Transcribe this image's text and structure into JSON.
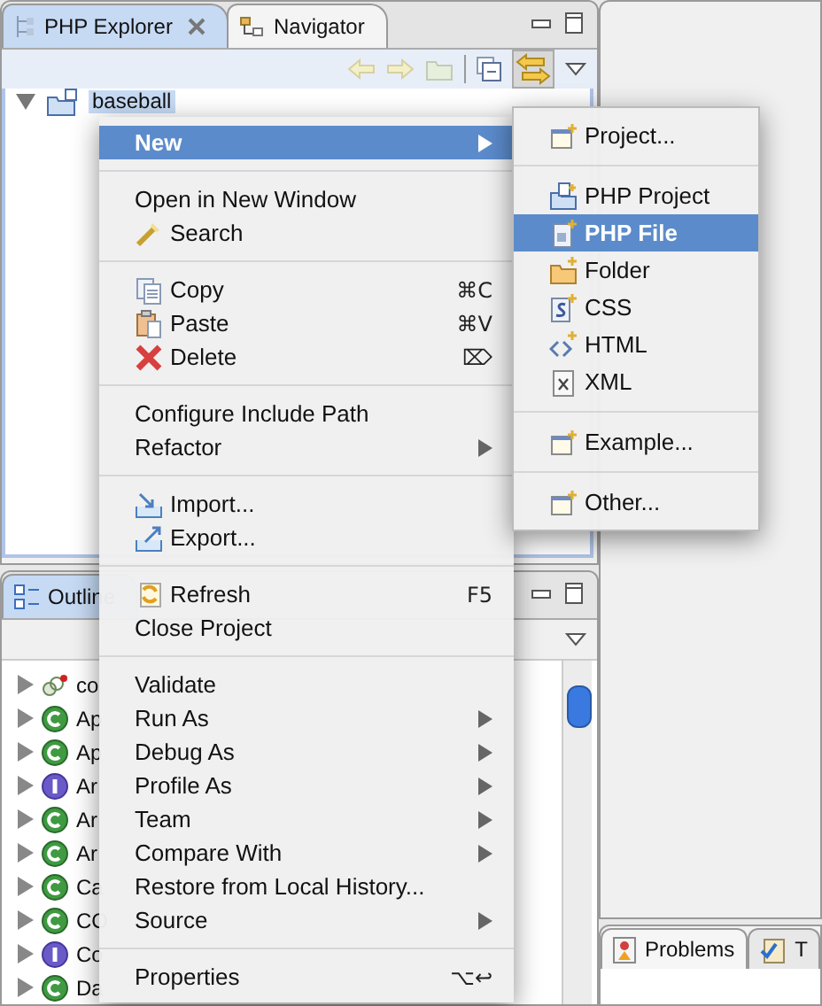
{
  "explorer": {
    "tabs": [
      {
        "label": "PHP Explorer",
        "selected": true
      },
      {
        "label": "Navigator",
        "selected": false
      }
    ],
    "tree": [
      {
        "label": "baseball",
        "expanded": true,
        "selected": true
      }
    ]
  },
  "context_menu": {
    "items": [
      {
        "kind": "item",
        "label": "New",
        "submenu": true,
        "selected": true
      },
      {
        "kind": "separator"
      },
      {
        "kind": "item",
        "label": "Open in New Window",
        "selected": false
      },
      {
        "kind": "item",
        "label": "Search",
        "selected": false
      },
      {
        "kind": "separator"
      },
      {
        "kind": "item",
        "label": "Copy",
        "shortcut": "⌘C",
        "selected": false
      },
      {
        "kind": "item",
        "label": "Paste",
        "shortcut": "⌘V",
        "selected": false
      },
      {
        "kind": "item",
        "label": "Delete",
        "shortcut": "⌦",
        "selected": false
      },
      {
        "kind": "separator"
      },
      {
        "kind": "item",
        "label": "Configure Include Path",
        "selected": false
      },
      {
        "kind": "item",
        "label": "Refactor",
        "submenu": true,
        "selected": false
      },
      {
        "kind": "separator"
      },
      {
        "kind": "item",
        "label": "Import...",
        "selected": false
      },
      {
        "kind": "item",
        "label": "Export...",
        "selected": false
      },
      {
        "kind": "separator"
      },
      {
        "kind": "item",
        "label": "Refresh",
        "shortcut": "F5",
        "selected": false
      },
      {
        "kind": "item",
        "label": "Close Project",
        "selected": false
      },
      {
        "kind": "separator"
      },
      {
        "kind": "item",
        "label": "Validate",
        "selected": false
      },
      {
        "kind": "item",
        "label": "Run As",
        "submenu": true,
        "selected": false
      },
      {
        "kind": "item",
        "label": "Debug As",
        "submenu": true,
        "selected": false
      },
      {
        "kind": "item",
        "label": "Profile As",
        "submenu": true,
        "selected": false
      },
      {
        "kind": "item",
        "label": "Team",
        "submenu": true,
        "selected": false
      },
      {
        "kind": "item",
        "label": "Compare With",
        "submenu": true,
        "selected": false
      },
      {
        "kind": "item",
        "label": "Restore from Local History...",
        "selected": false
      },
      {
        "kind": "item",
        "label": "Source",
        "submenu": true,
        "selected": false
      },
      {
        "kind": "separator"
      },
      {
        "kind": "item",
        "label": "Properties",
        "shortcut": "⌥↩",
        "selected": false
      }
    ]
  },
  "new_submenu": {
    "items": [
      {
        "kind": "item",
        "label": "Project...",
        "selected": false
      },
      {
        "kind": "separator"
      },
      {
        "kind": "item",
        "label": "PHP Project",
        "selected": false
      },
      {
        "kind": "item",
        "label": "PHP File",
        "selected": true
      },
      {
        "kind": "item",
        "label": "Folder",
        "selected": false
      },
      {
        "kind": "item",
        "label": "CSS",
        "selected": false
      },
      {
        "kind": "item",
        "label": "HTML",
        "selected": false
      },
      {
        "kind": "item",
        "label": "XML",
        "selected": false
      },
      {
        "kind": "separator"
      },
      {
        "kind": "item",
        "label": "Example...",
        "selected": false
      },
      {
        "kind": "separator"
      },
      {
        "kind": "item",
        "label": "Other...",
        "selected": false
      }
    ]
  },
  "outline": {
    "tab": "Outline",
    "items": [
      {
        "kind": "constant",
        "label": "co",
        "expanded": false
      },
      {
        "kind": "class",
        "label": "Ap",
        "expanded": false
      },
      {
        "kind": "class",
        "label": "Ap",
        "expanded": false
      },
      {
        "kind": "interface",
        "label": "Ar",
        "expanded": false
      },
      {
        "kind": "class",
        "label": "Ar",
        "expanded": false
      },
      {
        "kind": "class",
        "label": "Ar",
        "expanded": false
      },
      {
        "kind": "class",
        "label": "Ca",
        "expanded": false
      },
      {
        "kind": "class",
        "label": "CO",
        "expanded": false
      },
      {
        "kind": "interface",
        "label": "Co",
        "expanded": false
      },
      {
        "kind": "class",
        "label": "Da",
        "expanded": false
      }
    ]
  },
  "problems": {
    "tabs": [
      {
        "label": "Problems",
        "selected": true
      },
      {
        "label": "T",
        "selected": false
      }
    ]
  }
}
